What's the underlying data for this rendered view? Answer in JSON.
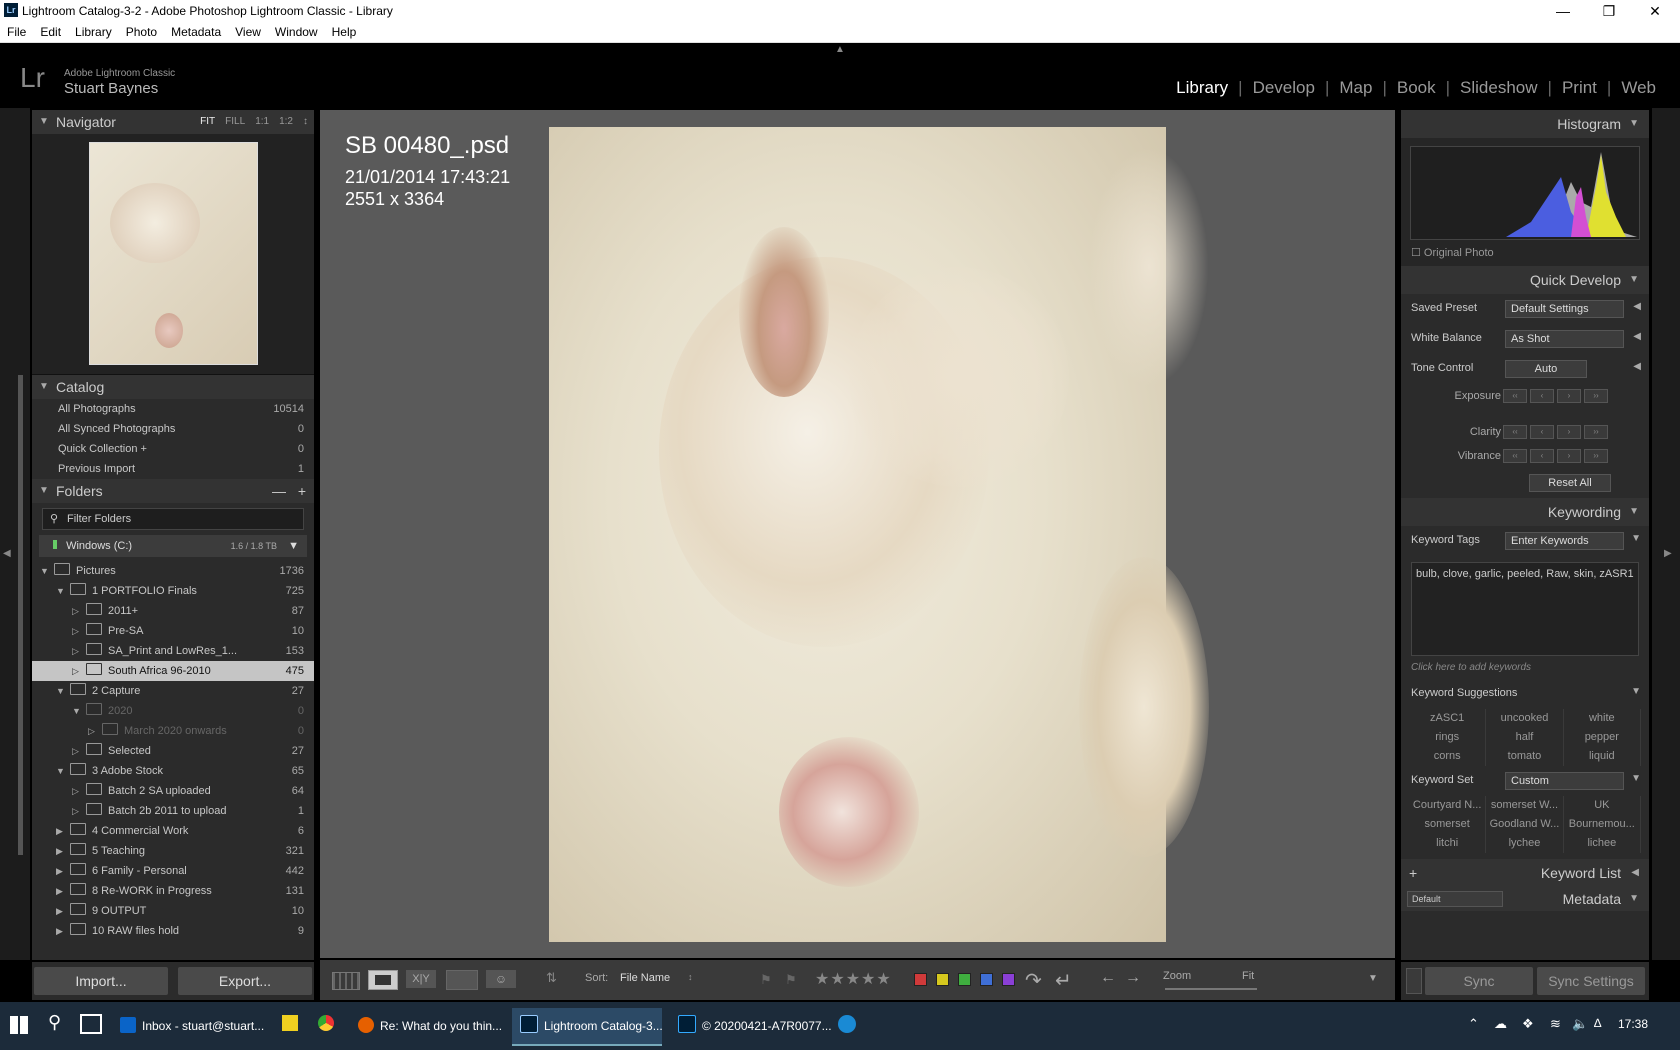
{
  "window": {
    "title": "Lightroom Catalog-3-2 - Adobe Photoshop Lightroom Classic - Library",
    "app_icon": "Lr"
  },
  "menu": [
    "File",
    "Edit",
    "Library",
    "Photo",
    "Metadata",
    "View",
    "Window",
    "Help"
  ],
  "identity": {
    "logo": "Lr",
    "app_name": "Adobe Lightroom Classic",
    "user": "Stuart Baynes"
  },
  "modules": [
    "Library",
    "Develop",
    "Map",
    "Book",
    "Slideshow",
    "Print",
    "Web"
  ],
  "navigator": {
    "title": "Navigator",
    "options": [
      "FIT",
      "FILL",
      "1:1",
      "1:2"
    ]
  },
  "catalog": {
    "title": "Catalog",
    "items": [
      {
        "label": "All Photographs",
        "count": "10514"
      },
      {
        "label": "All Synced Photographs",
        "count": "0"
      },
      {
        "label": "Quick Collection  +",
        "count": "0"
      },
      {
        "label": "Previous Import",
        "count": "1"
      }
    ]
  },
  "folders": {
    "title": "Folders",
    "filter_placeholder": "Filter Folders",
    "drive": {
      "name": "Windows (C:)",
      "size": "1.6 / 1.8 TB"
    },
    "items": [
      {
        "label": "Pictures",
        "count": "1736"
      },
      {
        "label": "1 PORTFOLIO Finals",
        "count": "725"
      },
      {
        "label": "2011+",
        "count": "87"
      },
      {
        "label": "Pre-SA",
        "count": "10"
      },
      {
        "label": "SA_Print and LowRes_1...",
        "count": "153"
      },
      {
        "label": "South Africa 96-2010",
        "count": "475"
      },
      {
        "label": "2 Capture",
        "count": "27"
      },
      {
        "label": "2020",
        "count": "0"
      },
      {
        "label": "March 2020 onwards",
        "count": "0"
      },
      {
        "label": "Selected",
        "count": "27"
      },
      {
        "label": "3 Adobe Stock",
        "count": "65"
      },
      {
        "label": "Batch 2 SA uploaded",
        "count": "64"
      },
      {
        "label": "Batch 2b 2011 to upload",
        "count": "1"
      },
      {
        "label": "4 Commercial Work",
        "count": "6"
      },
      {
        "label": "5 Teaching",
        "count": "321"
      },
      {
        "label": "6 Family - Personal",
        "count": "442"
      },
      {
        "label": "8 Re-WORK in Progress",
        "count": "131"
      },
      {
        "label": "9 OUTPUT",
        "count": "10"
      },
      {
        "label": "10 RAW files hold",
        "count": "9"
      }
    ]
  },
  "left_buttons": {
    "import": "Import...",
    "export": "Export..."
  },
  "photo_info": {
    "filename": "SB 00480_.psd",
    "datetime": "21/01/2014 17:43:21",
    "dimensions": "2551 x 3364"
  },
  "toolbar": {
    "sort_label": "Sort:",
    "sort_value": "File Name",
    "zoom_label": "Zoom",
    "zoom_value": "Fit",
    "label_colors": [
      "#d03a3a",
      "#d6c81e",
      "#3fae3f",
      "#3f6fd6",
      "#8a3fd6"
    ]
  },
  "histogram": {
    "title": "Histogram",
    "original_photo": "Original Photo"
  },
  "quick_develop": {
    "title": "Quick Develop",
    "saved_preset_label": "Saved Preset",
    "saved_preset": "Default Settings",
    "white_balance_label": "White Balance",
    "white_balance": "As Shot",
    "tone_control_label": "Tone Control",
    "auto": "Auto",
    "exposure": "Exposure",
    "clarity": "Clarity",
    "vibrance": "Vibrance",
    "reset": "Reset All"
  },
  "keywording": {
    "title": "Keywording",
    "tags_label": "Keyword Tags",
    "tags_mode": "Enter Keywords",
    "keywords": "bulb, clove, garlic, peeled, Raw, skin, zASR1",
    "add_placeholder": "Click here to add keywords",
    "suggestions_title": "Keyword Suggestions",
    "suggestions": [
      "zASC1",
      "uncooked",
      "white",
      "rings",
      "half",
      "pepper",
      "corns",
      "tomato",
      "liquid"
    ],
    "set_label": "Keyword Set",
    "set_value": "Custom",
    "set_items": [
      "Courtyard N...",
      "somerset W...",
      "UK",
      "somerset",
      "Goodland W...",
      "Bournemou...",
      "litchi",
      "lychee",
      "lichee"
    ]
  },
  "keyword_list": {
    "title": "Keyword List"
  },
  "metadata": {
    "title": "Metadata",
    "preset": "Default"
  },
  "sync": {
    "sync": "Sync",
    "sync_settings": "Sync Settings"
  },
  "taskbar": {
    "items": [
      "Inbox - stuart@stuart...",
      "Re: What do you thin...",
      "Lightroom Catalog-3...",
      "© 20200421-A7R0077..."
    ],
    "time": "17:38"
  }
}
